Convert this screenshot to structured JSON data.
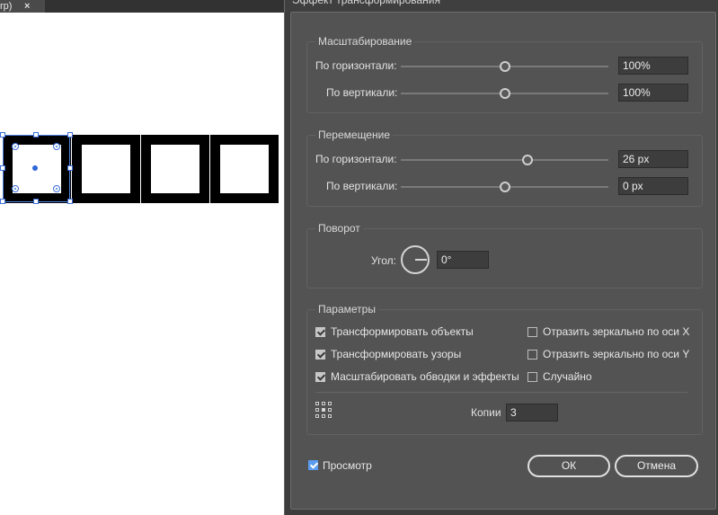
{
  "document": {
    "tab_label": "rp)",
    "tab_close": "×"
  },
  "dialog": {
    "title": "Эффект трансформирования",
    "scale": {
      "title": "Масштабирование",
      "horizontal_label": "По горизонтали:",
      "horizontal_value": "100%",
      "horizontal_level": 0.5,
      "vertical_label": "По вертикали:",
      "vertical_value": "100%",
      "vertical_level": 0.5
    },
    "move": {
      "title": "Перемещение",
      "horizontal_label": "По горизонтали:",
      "horizontal_value": "26 px",
      "horizontal_level": 0.61,
      "vertical_label": "По вертикали:",
      "vertical_value": "0 px",
      "vertical_level": 0.5
    },
    "rotate": {
      "title": "Поворот",
      "angle_label": "Угол:",
      "angle_value": "0°"
    },
    "options": {
      "title": "Параметры",
      "transform_objects": {
        "label": "Трансформировать объекты",
        "checked": true
      },
      "transform_patterns": {
        "label": "Трансформировать узоры",
        "checked": true
      },
      "scale_strokes": {
        "label": "Масштабировать обводки и эффекты",
        "checked": true
      },
      "reflect_x": {
        "label": "Отразить зеркально по оси X",
        "checked": false
      },
      "reflect_y": {
        "label": "Отразить зеркально по оси Y",
        "checked": false
      },
      "random": {
        "label": "Случайно",
        "checked": false
      },
      "copies_label": "Копии",
      "copies_value": "3"
    },
    "preview": {
      "label": "Просмотр",
      "checked": true
    },
    "ok_label": "ОК",
    "cancel_label": "Отмена"
  }
}
